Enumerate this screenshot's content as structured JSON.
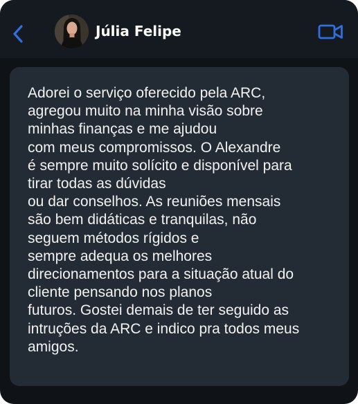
{
  "header": {
    "back_icon": "chevron-left-icon",
    "contact_name": "Júlia Felipe",
    "video_icon": "video-camera-icon",
    "accent_color": "#2f6fdf"
  },
  "message": {
    "text": "Adorei o serviço oferecido pela ARC,\nagregou muito na minha visão sobre\nminhas finanças e me ajudou\ncom meus compromissos. O Alexandre\né sempre muito solícito e disponível para\ntirar todas as dúvidas\nou dar conselhos. As reuniões mensais\nsão bem didáticas e tranquilas, não\nseguem métodos rígidos e\nsempre adequa os melhores\ndirecionamentos para a situação atual do\ncliente pensando nos planos\nfuturos. Gostei demais de ter seguido as\nintruções da ARC e indico pra todos meus\namigos."
  },
  "theme": {
    "background": "#0f1317",
    "header_background": "#141a1f",
    "bubble_background": "#232c35",
    "text_color": "#f2f2f2"
  }
}
